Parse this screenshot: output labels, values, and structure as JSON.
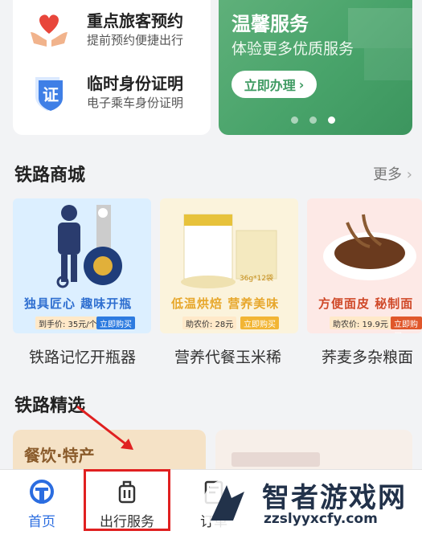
{
  "services": [
    {
      "title": "重点旅客预约",
      "subtitle": "提前预约便捷出行",
      "icon": "heart-hands-icon"
    },
    {
      "title": "临时身份证明",
      "subtitle": "电子乘车身份证明",
      "icon": "id-shield-icon"
    }
  ],
  "banner": {
    "title": "温馨服务",
    "subtitle": "体验更多优质服务",
    "button": "立即办理",
    "page_count": 3,
    "active_page": 3
  },
  "mall": {
    "title": "铁路商城",
    "more": "更多",
    "products": [
      {
        "name": "铁路记忆开瓶器",
        "tag": "独具匠心 趣味开瓶",
        "price": "到手价: 35元/个",
        "buy": "立即购买",
        "bg": "#dcefff",
        "accent": "#2f6fd0"
      },
      {
        "name": "营养代餐玉米稀",
        "tag": "低温烘焙 营养美味",
        "price": "助农价: 28元",
        "buy": "立即购买",
        "bg": "#fbf3dc",
        "accent": "#e7a72b"
      },
      {
        "name": "荞麦多杂粮面",
        "tag": "方便面皮 秘制面",
        "price": "助农价: 19.9元",
        "buy": "立即购买",
        "bg": "#fde9e6",
        "accent": "#d04a2a"
      }
    ]
  },
  "selected": {
    "title": "铁路精选",
    "card1": "餐饮·特产"
  },
  "tabbar": {
    "items": [
      {
        "label": "首页",
        "active": true
      },
      {
        "label": "出行服务",
        "active": false
      },
      {
        "label": "订单",
        "active": false
      }
    ]
  },
  "watermark": {
    "text": "智者游戏网",
    "url": "zzslyyxcfy.com"
  }
}
